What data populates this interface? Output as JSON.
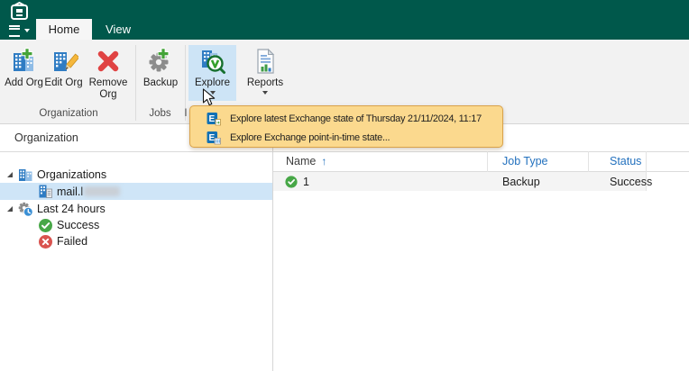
{
  "titlebar": {
    "tabs": [
      {
        "label": "Home",
        "active": true
      },
      {
        "label": "View",
        "active": false
      }
    ]
  },
  "ribbon": {
    "groups": [
      {
        "label": "Organization",
        "buttons": [
          {
            "label": "Add Org",
            "icon": "add-org-icon"
          },
          {
            "label": "Edit Org",
            "icon": "edit-org-icon"
          },
          {
            "label": "Remove Org",
            "icon": "remove-org-icon"
          }
        ]
      },
      {
        "label": "Jobs",
        "buttons": [
          {
            "label": "Backup",
            "icon": "backup-icon"
          }
        ]
      },
      {
        "label": "I",
        "buttons": [
          {
            "label": "Explore",
            "icon": "explore-icon",
            "highlighted": true,
            "has_dropdown": true
          },
          {
            "label": "Reports",
            "icon": "reports-icon",
            "has_dropdown": true
          }
        ]
      }
    ]
  },
  "explore_menu": {
    "items": [
      {
        "icon": "exchange-latest-icon",
        "label": "Explore latest Exchange state of Thursday 21/11/2024, 11:17"
      },
      {
        "icon": "exchange-point-in-time-icon",
        "label": "Explore Exchange point-in-time state..."
      }
    ]
  },
  "sidebar": {
    "header": "Organization",
    "tree": [
      {
        "label": "Organizations",
        "icon": "organizations-icon",
        "expanded": true
      },
      {
        "label": "mail.l",
        "redacted": true,
        "icon": "organization-icon",
        "selected": true
      },
      {
        "label": "Last 24 hours",
        "icon": "last-24-hours-icon",
        "expanded": true
      },
      {
        "label": "Success",
        "icon": "success-icon"
      },
      {
        "label": "Failed",
        "icon": "failed-icon"
      }
    ]
  },
  "table": {
    "sort_arrow": "↑",
    "columns": [
      {
        "label": "Name",
        "sorted": "asc"
      },
      {
        "label": "Job Type"
      },
      {
        "label": "Status"
      }
    ],
    "rows": [
      {
        "name": "1",
        "job_type": "Backup",
        "status": "Success",
        "status_icon": "success"
      }
    ]
  },
  "colors": {
    "titlebar_teal": "#00584B",
    "ribbon_bg": "#F2F2F2",
    "highlight_blue": "#CDE4F6",
    "selection_blue": "#CFE5F7",
    "menu_orange_bg": "#FBD98E",
    "menu_orange_border": "#D9A24A",
    "header_link_blue": "#2371BE",
    "success_green": "#47A747",
    "failed_red": "#D9534F"
  }
}
